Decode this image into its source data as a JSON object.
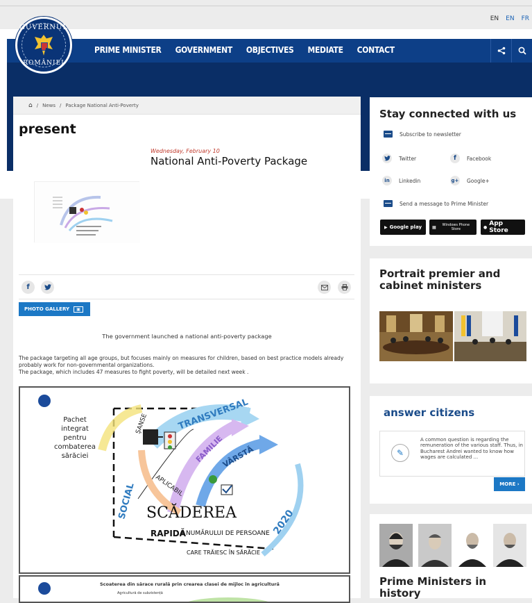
{
  "languages": [
    "EN",
    "EN",
    "FR"
  ],
  "logo": {
    "top": "GUVERNUL",
    "bottom": "ROMÂNIEI"
  },
  "nav": {
    "items": [
      "PRIME MINISTER",
      "GOVERNMENT",
      "OBJECTIVES",
      "MEDIATE",
      "CONTACT"
    ],
    "share_icon": "share-icon",
    "search_icon": "search-icon"
  },
  "breadcrumb": {
    "home_icon": "home-icon",
    "sep": "/",
    "news": "News",
    "current": "Package National Anti-Poverty"
  },
  "article": {
    "page_title": "present",
    "date": "Wednesday, February 10",
    "headline": "National Anti-Poverty Package",
    "photo_gallery": "PHOTO GALLERY",
    "lead": "The government launched a national anti-poverty package",
    "body1": "The package targeting all age groups, but focuses mainly on measures for children, based on best practice models already probably work for non-governmental organizations.",
    "body2": "The package, which includes 47 measures to fight poverty, will be detailed next week .",
    "infographic": {
      "pachet": "Pachet integrat pentru combaterea sărăciei",
      "transversal": "TRANSVERSAL",
      "familie": "FAMILIE",
      "varsta": "VÂRSTĂ",
      "social": "SOCIAL",
      "scaderea": "SCĂDEREA",
      "rapida": "RAPIDĂ",
      "numarului": "A NUMĂRULUI DE PERSOANE",
      "saracie": "CARE TRĂIESC ÎN SĂRĂCIE",
      "year": "2020"
    },
    "infographic2": {
      "title": "Scoaterea din sărace rurală prin crearea clasei de mijloc în agricultură",
      "sub": "Agricultură de subzistență"
    }
  },
  "sidebar": {
    "connected": {
      "title": "Stay connected with us",
      "subscribe": "Subscribe to newsletter",
      "twitter": "Twitter",
      "facebook": "Facebook",
      "linkedin": "Linkedin",
      "google": "Google+",
      "message": "Send a message to Prime Minister",
      "store_google": "Google play",
      "store_windows": "Windows Phone Store",
      "store_apple": "App Store"
    },
    "portrait": {
      "title": "Portrait premier and cabinet ministers"
    },
    "answer": {
      "title": "answer citizens",
      "text": "A common question is regarding the remuneration of the various staff. Thus, in Bucharest Andrei wanted to know how wages are calculated ...",
      "more": "MORE ›"
    },
    "history": {
      "title": "Prime Ministers in history"
    }
  }
}
